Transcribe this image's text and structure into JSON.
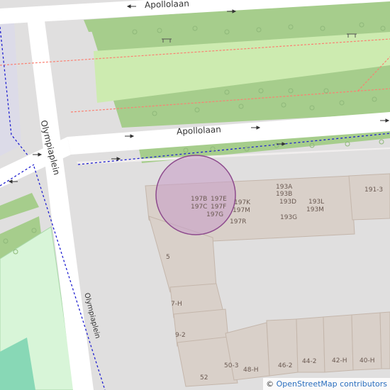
{
  "map": {
    "streets": {
      "apollolaan_top": "Apollolaan",
      "apollolaan_main": "Apollolaan",
      "olympiaplein_left": "Olympiaplein",
      "olympiaplein_right": "Olympiaplein"
    },
    "house_numbers": {
      "n197b": "197B",
      "n197e": "197E",
      "n197c": "197C",
      "n197f": "197F",
      "n197g": "197G",
      "n197k": "197K",
      "n197m": "197M",
      "n197r": "197R",
      "n193a": "193A",
      "n193b": "193B",
      "n193d": "193D",
      "n193l": "193L",
      "n193m": "193M",
      "n193g": "193G",
      "n191_3": "191-3",
      "n5": "5",
      "n7h": "7-H",
      "n9_2": "9-2",
      "n50_3": "50-3",
      "n48h": "48-H",
      "n46_2": "46-2",
      "n44_2": "44-2",
      "n42h": "42-H",
      "n40h": "40-H",
      "n52": "52"
    },
    "attribution": {
      "symbol": "©",
      "text": "OpenStreetMap contributors"
    },
    "colors": {
      "background": "#e0dfdf",
      "road": "#ffffff",
      "park": "#a6cd8c",
      "grass": "#cdebb0",
      "pitch": "#d8f5d8",
      "pitch_inner": "#88d8b6",
      "building": "#d9d0c9",
      "building_outline": "#c4b6ab",
      "marker": "#c8a0c8",
      "marker_outline": "#8d4a8d",
      "footway": "#fa8072",
      "cycleway": "#2020d0"
    }
  }
}
